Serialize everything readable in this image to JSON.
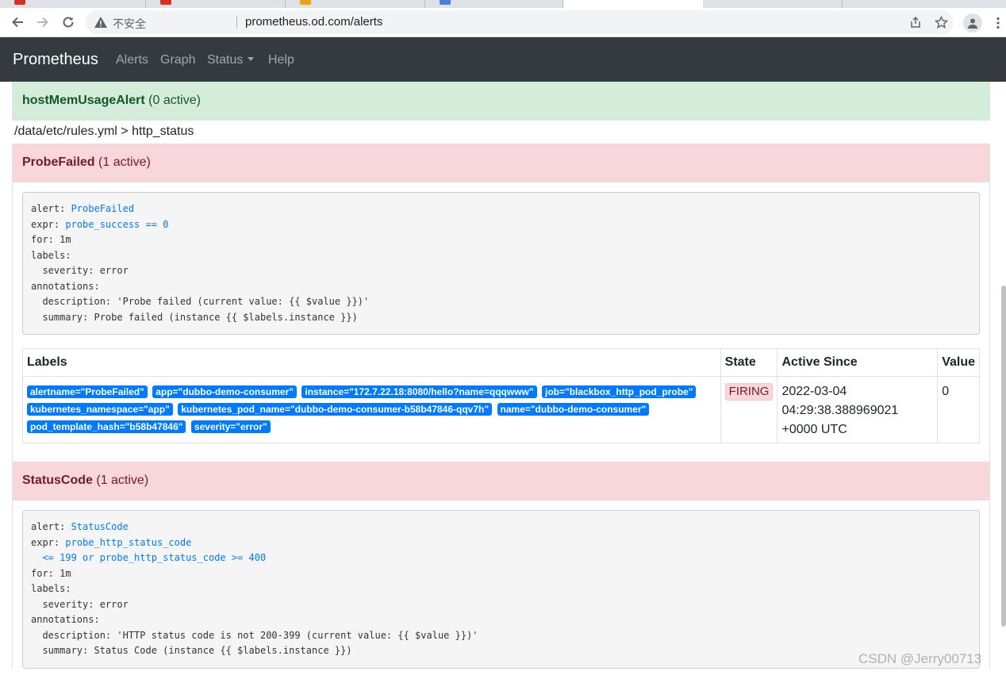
{
  "browser": {
    "security_label": "不安全",
    "url": "prometheus.od.com/alerts",
    "tab_colors": [
      "#d93025",
      "#d93025",
      "#e8a317",
      "#4a7fd6",
      "#8a8f96",
      "#8a8f96"
    ]
  },
  "navbar": {
    "brand": "Prometheus",
    "links": [
      "Alerts",
      "Graph",
      "Status",
      "Help"
    ]
  },
  "groups": {
    "first_alert": {
      "name": "hostMemUsageAlert",
      "count": "(0 active)"
    },
    "rule_group": "/data/etc/rules.yml > http_status",
    "probe": {
      "name": "ProbeFailed",
      "count": "(1 active)",
      "rule": {
        "alert_key": "alert: ",
        "alert_val": "ProbeFailed",
        "expr_key": "expr: ",
        "expr_val": "probe_success == 0",
        "rest": "for: 1m\nlabels:\n  severity: error\nannotations:\n  description: 'Probe failed (current value: {{ $value }})'\n  summary: Probe failed (instance {{ $labels.instance }})"
      },
      "table": {
        "headers": [
          "Labels",
          "State",
          "Active Since",
          "Value"
        ],
        "labels": [
          "alertname=\"ProbeFailed\"",
          "app=\"dubbo-demo-consumer\"",
          "instance=\"172.7.22.18:8080/hello?name=qqqwww\"",
          "job=\"blackbox_http_pod_probe\"",
          "kubernetes_namespace=\"app\"",
          "kubernetes_pod_name=\"dubbo-demo-consumer-b58b47846-qqv7h\"",
          "name=\"dubbo-demo-consumer\"",
          "pod_template_hash=\"b58b47846\"",
          "severity=\"error\""
        ],
        "state": "FIRING",
        "active_since": "2022-03-04 04:29:38.388969021 +0000 UTC",
        "value": "0"
      }
    },
    "status": {
      "name": "StatusCode",
      "count": "(1 active)",
      "rule": {
        "alert_key": "alert: ",
        "alert_val": "StatusCode",
        "expr_key": "expr: ",
        "expr_val": "probe_http_status_code\n  <= 199 or probe_http_status_code >= 400",
        "rest": "for: 1m\nlabels:\n  severity: error\nannotations:\n  description: 'HTTP status code is not 200-399 (current value: {{ $value }})'\n  summary: Status Code (instance {{ $labels.instance }})"
      }
    }
  },
  "watermark": "CSDN @Jerry00713"
}
